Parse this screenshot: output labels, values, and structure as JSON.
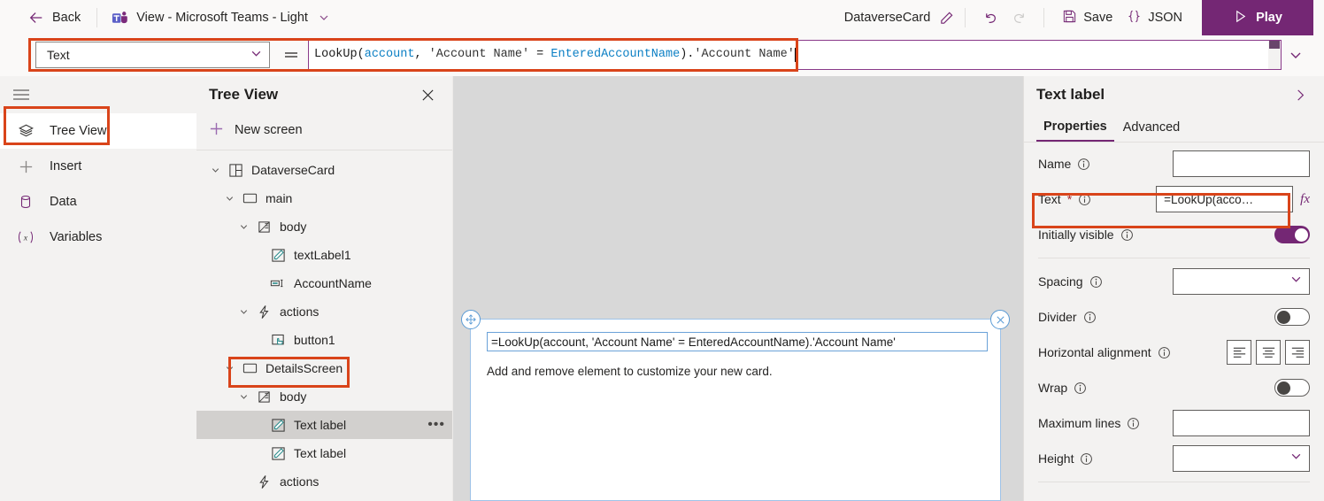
{
  "topbar": {
    "back_label": "Back",
    "back_icon": "arrow-left-icon",
    "app_title": "View - Microsoft Teams - Light",
    "app_icon": "microsoft-teams-icon",
    "title_chevron_icon": "chevron-down-icon",
    "doc_name": "DataverseCard",
    "rename_icon": "pencil-icon",
    "undo_icon": "undo-icon",
    "redo_icon": "redo-icon",
    "save_label": "Save",
    "save_icon": "floppy-disk-icon",
    "json_label": "JSON",
    "json_icon": "curly-braces-icon",
    "play_label": "Play",
    "play_icon": "play-triangle-icon",
    "accent_color": "#742774"
  },
  "formula_bar": {
    "property_selected": "Text",
    "property_chevron_icon": "chevron-down-icon",
    "equals_icon": "equals-sign-icon",
    "expand_icon": "chevron-down-icon",
    "formula_plain": "LookUp(account, 'Account Name' = EnteredAccountName).'Account Name'",
    "tokens": [
      {
        "t": "LookUp(",
        "k": "fn"
      },
      {
        "t": "account",
        "k": "ident"
      },
      {
        "t": ", ",
        "k": "op"
      },
      {
        "t": "'Account Name'",
        "k": "str"
      },
      {
        "t": " = ",
        "k": "op"
      },
      {
        "t": "EnteredAccountName",
        "k": "ident"
      },
      {
        "t": ").",
        "k": "op"
      },
      {
        "t": "'Account Name'",
        "k": "str"
      }
    ],
    "border_color": "#8a3a8a"
  },
  "rail": {
    "menu_icon": "hamburger-menu-icon",
    "items": [
      {
        "label": "Tree View",
        "icon": "layers-icon",
        "active": true
      },
      {
        "label": "Insert",
        "icon": "plus-icon",
        "active": false
      },
      {
        "label": "Data",
        "icon": "database-icon",
        "active": false
      },
      {
        "label": "Variables",
        "icon": "variable-x-icon",
        "active": false
      }
    ]
  },
  "tree_panel": {
    "title": "Tree View",
    "close_icon": "close-icon",
    "new_screen_label": "New screen",
    "new_screen_icon": "plus-icon",
    "nodes": [
      {
        "label": "DataverseCard",
        "icon": "card-layout-icon",
        "indent": 0,
        "twisty": "expanded",
        "selected": false,
        "more": false
      },
      {
        "label": "main",
        "icon": "rectangle-icon",
        "indent": 1,
        "twisty": "expanded",
        "selected": false,
        "more": false
      },
      {
        "label": "body",
        "icon": "body-container-icon",
        "indent": 2,
        "twisty": "expanded",
        "selected": false,
        "more": false
      },
      {
        "label": "textLabel1",
        "icon": "text-label-icon",
        "indent": 3,
        "twisty": "none",
        "selected": false,
        "more": false
      },
      {
        "label": "AccountName",
        "icon": "text-input-icon",
        "indent": 3,
        "twisty": "none",
        "selected": false,
        "more": false
      },
      {
        "label": "actions",
        "icon": "lightning-icon",
        "indent": 2,
        "twisty": "expanded",
        "selected": false,
        "more": false
      },
      {
        "label": "button1",
        "icon": "button-click-icon",
        "indent": 3,
        "twisty": "none",
        "selected": false,
        "more": false
      },
      {
        "label": "DetailsScreen",
        "icon": "rectangle-icon",
        "indent": 1,
        "twisty": "expanded",
        "selected": false,
        "more": false
      },
      {
        "label": "body",
        "icon": "body-container-icon",
        "indent": 2,
        "twisty": "expanded",
        "selected": false,
        "more": false
      },
      {
        "label": "Text label",
        "icon": "text-label-icon",
        "indent": 3,
        "twisty": "none",
        "selected": true,
        "more": true
      },
      {
        "label": "Text label",
        "icon": "text-label-icon",
        "indent": 3,
        "twisty": "none",
        "selected": false,
        "more": false
      },
      {
        "label": "actions",
        "icon": "lightning-icon",
        "indent": 2,
        "twisty": "none",
        "selected": false,
        "more": false
      }
    ],
    "more_glyph": "•••"
  },
  "canvas": {
    "card_text_value": "=LookUp(account, 'Account Name' = EnteredAccountName).'Account Name'",
    "card_subtext": "Add and remove element to customize your new card.",
    "move_handle_icon": "move-four-arrows-icon",
    "close_handle_icon": "close-circle-icon"
  },
  "properties": {
    "title": "Text label",
    "expand_icon": "chevron-right-icon",
    "tabs": [
      {
        "label": "Properties",
        "active": true
      },
      {
        "label": "Advanced",
        "active": false
      }
    ],
    "info_icon": "info-circle-icon",
    "fx_label": "fx",
    "rows": [
      {
        "label": "Name",
        "required": false,
        "control": "text",
        "value": "",
        "fx": false
      },
      {
        "label": "Text",
        "required": true,
        "control": "text",
        "value": "=LookUp(acco…",
        "fx": true
      },
      {
        "label": "Initially visible",
        "required": false,
        "control": "toggle",
        "toggle_on": true
      },
      {
        "label": "Spacing",
        "required": false,
        "control": "dropdown",
        "value": ""
      },
      {
        "label": "Divider",
        "required": false,
        "control": "toggle",
        "toggle_on": false
      },
      {
        "label": "Horizontal alignment",
        "required": false,
        "control": "align",
        "options": [
          "align-left-icon",
          "align-center-icon",
          "align-right-icon"
        ]
      },
      {
        "label": "Wrap",
        "required": false,
        "control": "toggle",
        "toggle_on": false
      },
      {
        "label": "Maximum lines",
        "required": false,
        "control": "text",
        "value": ""
      },
      {
        "label": "Height",
        "required": false,
        "control": "dropdown",
        "value": ""
      }
    ]
  },
  "annotations": {
    "color": "#d9441a",
    "boxes": [
      "formula-bar",
      "tree-view-rail-item",
      "details-screen-node",
      "text-property-row"
    ]
  }
}
